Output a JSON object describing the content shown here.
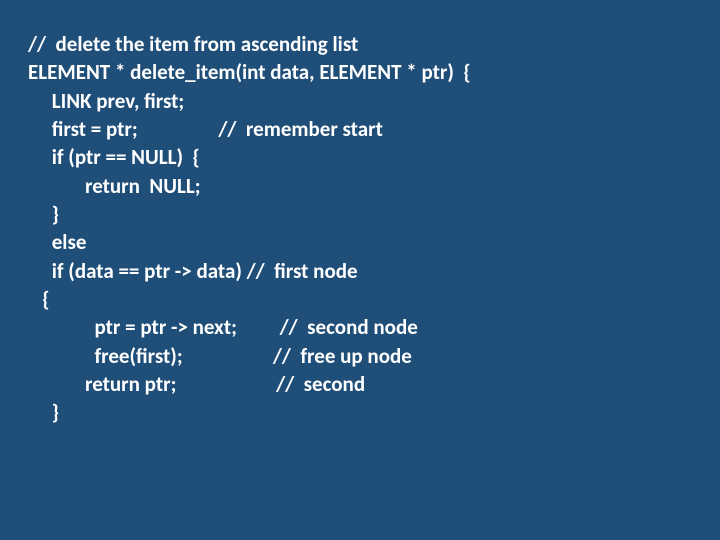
{
  "code": {
    "l01": "//  delete the item from ascending list",
    "l02": "ELEMENT * delete_item(int data, ELEMENT * ptr)  {",
    "l03": "     LINK prev, first;",
    "l04": "     first = ptr;                 //  remember start",
    "l05": "     if (ptr == NULL)  {",
    "l06": "            return  NULL;",
    "l07": "     }",
    "l08": "     else",
    "l09": "     if (data == ptr -> data) //  first node",
    "l10": "   {",
    "l11": "              ptr = ptr -> next;         //  second node",
    "l12": "              free(first);                   //  free up node",
    "l13": "            return ptr;                     //  second",
    "l14": "     }"
  }
}
